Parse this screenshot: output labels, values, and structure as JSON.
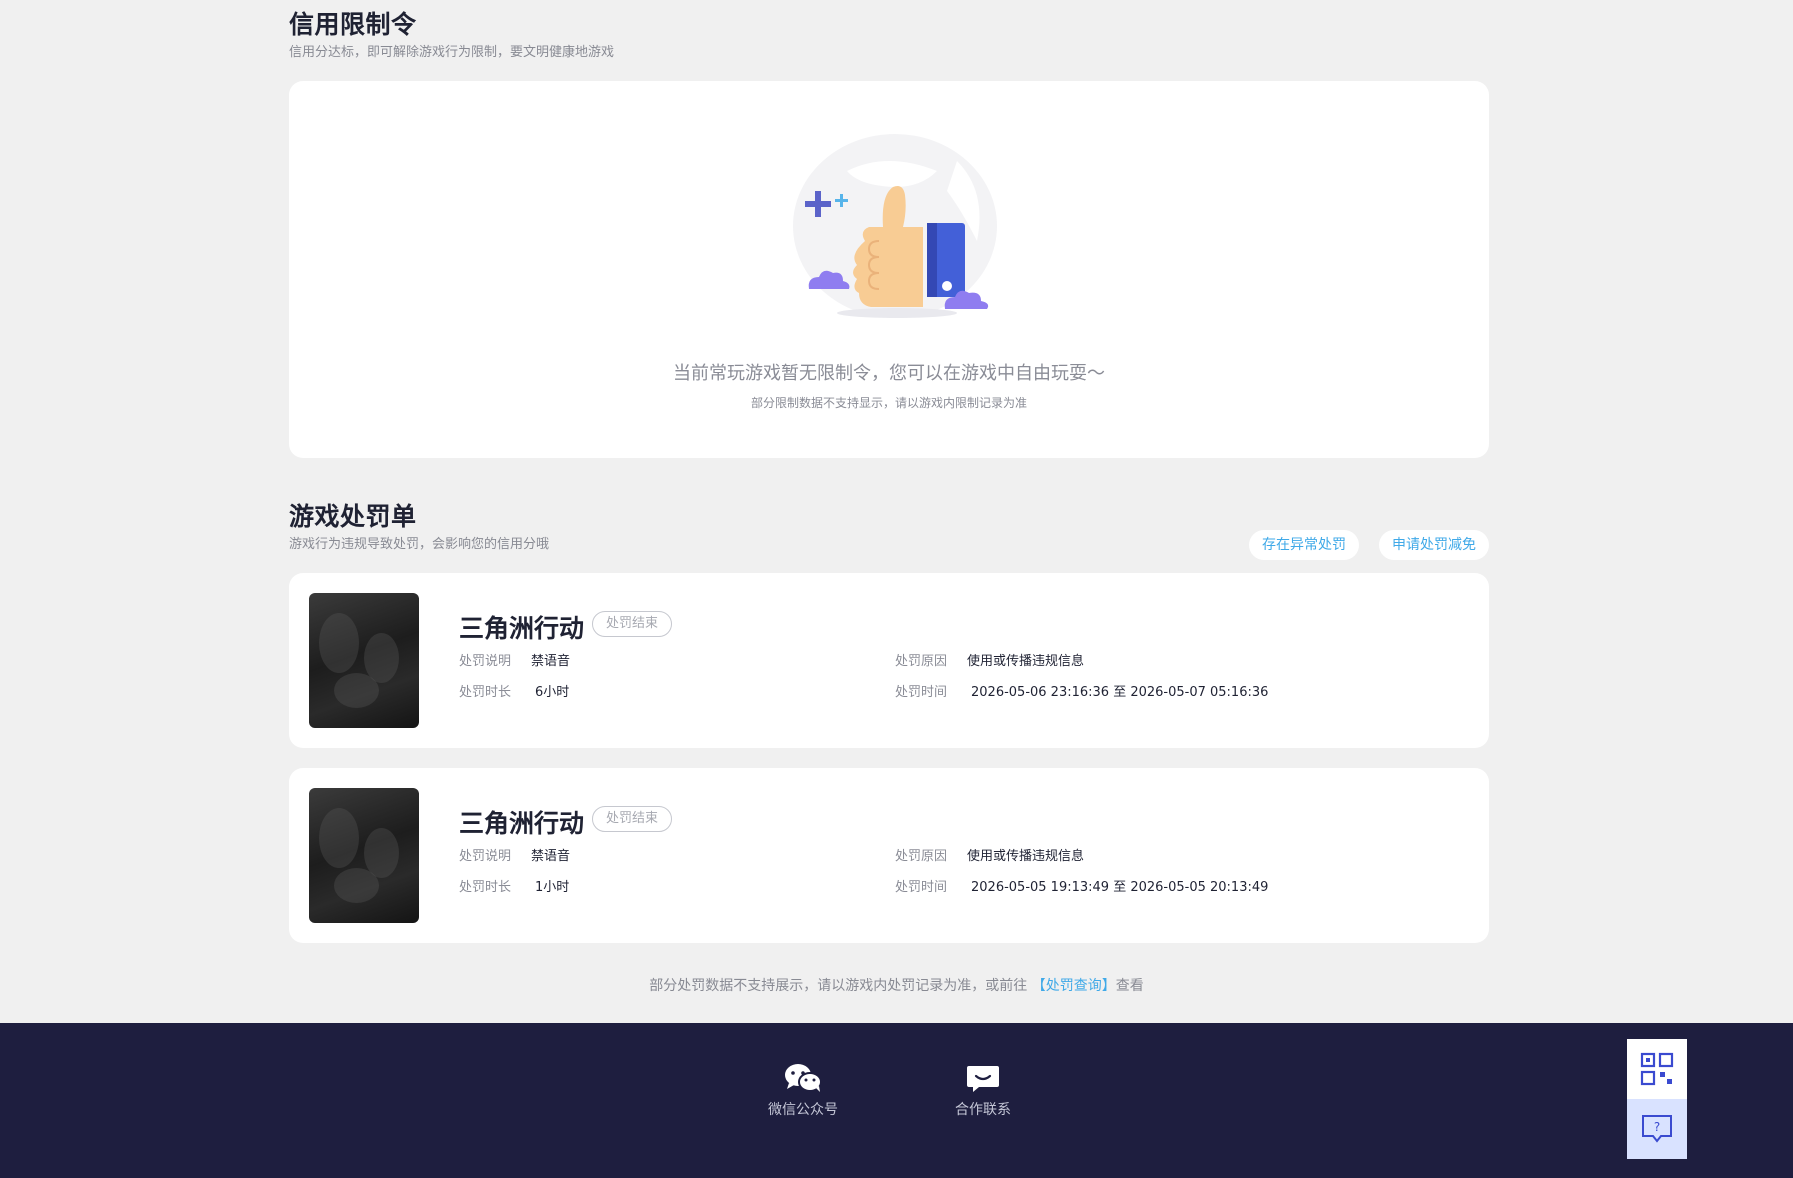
{
  "credit": {
    "title": "信用限制令",
    "subtitle": "信用分达标，即可解除游戏行为限制，要文明健康地游戏",
    "empty_text": "当前常玩游戏暂无限制令，您可以在游戏中自由玩耍～",
    "empty_note": "部分限制数据不支持显示，请以游戏内限制记录为准"
  },
  "penalty": {
    "title": "游戏处罚单",
    "subtitle": "游戏行为违规导致处罚，会影响您的信用分哦",
    "abnormal_button": "存在异常处罚",
    "reduce_button": "申请处罚减免",
    "labels": {
      "desc": "处罚说明",
      "duration": "处罚时长",
      "reason": "处罚原因",
      "time": "处罚时间"
    },
    "items": [
      {
        "game": "三角洲行动",
        "status": "处罚结束",
        "desc": "禁语音",
        "duration": "6小时",
        "reason": "使用或传播违规信息",
        "time": "2026-05-06 23:16:36 至 2026-05-07 05:16:36"
      },
      {
        "game": "三角洲行动",
        "status": "处罚结束",
        "desc": "禁语音",
        "duration": "1小时",
        "reason": "使用或传播违规信息",
        "time": "2026-05-05 19:13:49 至 2026-05-05 20:13:49"
      }
    ]
  },
  "footer_note": {
    "prefix": "部分处罚数据不支持展示，请以游戏内处罚记录为准，或前往 ",
    "link": "【处罚查询】",
    "suffix": "查看"
  },
  "footer": {
    "wechat_label": "微信公众号",
    "contact_label": "合作联系"
  },
  "icons": {
    "thumbs_up": "thumbs-up-illustration",
    "wechat": "wechat-icon",
    "chat": "chat-bubble-icon",
    "qr": "qr-code-icon",
    "help": "help-icon"
  },
  "colors": {
    "background": "#f0f0f0",
    "card": "#ffffff",
    "accent_link": "#3fa9e8",
    "footer_bg": "#1e1e3f",
    "title": "#1f2233"
  }
}
